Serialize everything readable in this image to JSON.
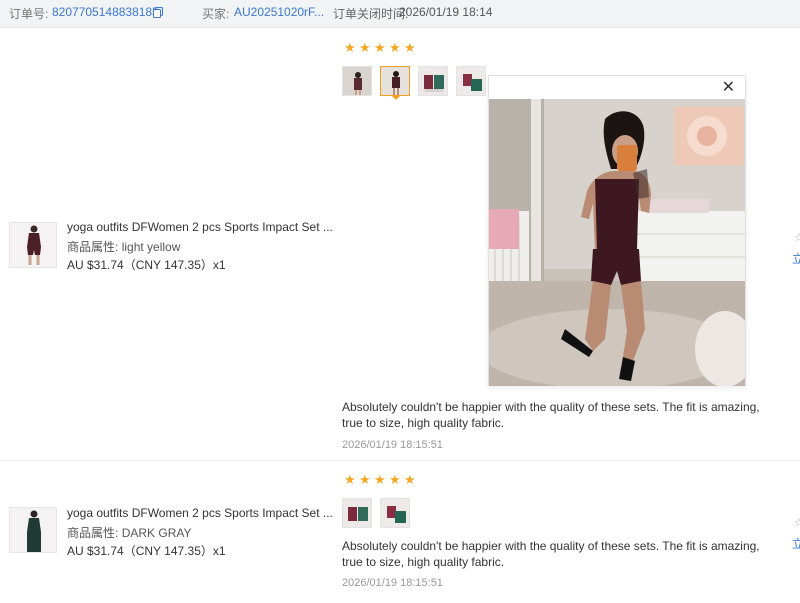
{
  "header": {
    "order_label": "订单号:",
    "order_value": "8207705148838185",
    "buyer_label": "买家:",
    "buyer_value": "AU20251020rF...",
    "close_label": "订单关闭时间:",
    "close_value": "2026/01/19 18:14"
  },
  "reviews": [
    {
      "product_name": "yoga outfits DFWomen 2 pcs Sports Impact Set ...",
      "attr_label": "商品属性:",
      "attr_value": "light yellow",
      "price": "AU $31.74（CNY 147.35）x1",
      "stars": [
        "★",
        "★",
        "★",
        "★",
        "★"
      ],
      "text": "Absolutely couldn't be happier with the quality of these sets. The fit is amazing, true to size, high quality fabric.",
      "date": "2026/01/19 18:15:51",
      "edge_glyph": "立",
      "edge_glyph2": "☆"
    },
    {
      "product_name": "yoga outfits DFWomen 2 pcs Sports Impact Set ...",
      "attr_label": "商品属性:",
      "attr_value": "DARK GRAY",
      "price": "AU $31.74（CNY 147.35）x1",
      "stars": [
        "★",
        "★",
        "★",
        "★",
        "★"
      ],
      "text": "Absolutely couldn't be happier with the quality of these sets. The fit is amazing, true to size, high quality fabric.",
      "date": "2026/01/19 18:15:51",
      "edge_glyph": "立",
      "edge_glyph2": "☆"
    }
  ],
  "preview": {
    "close_glyph": "✕"
  },
  "colors": {
    "link": "#3a78d6",
    "star": "#f5a623",
    "active_border": "#f0a020"
  }
}
